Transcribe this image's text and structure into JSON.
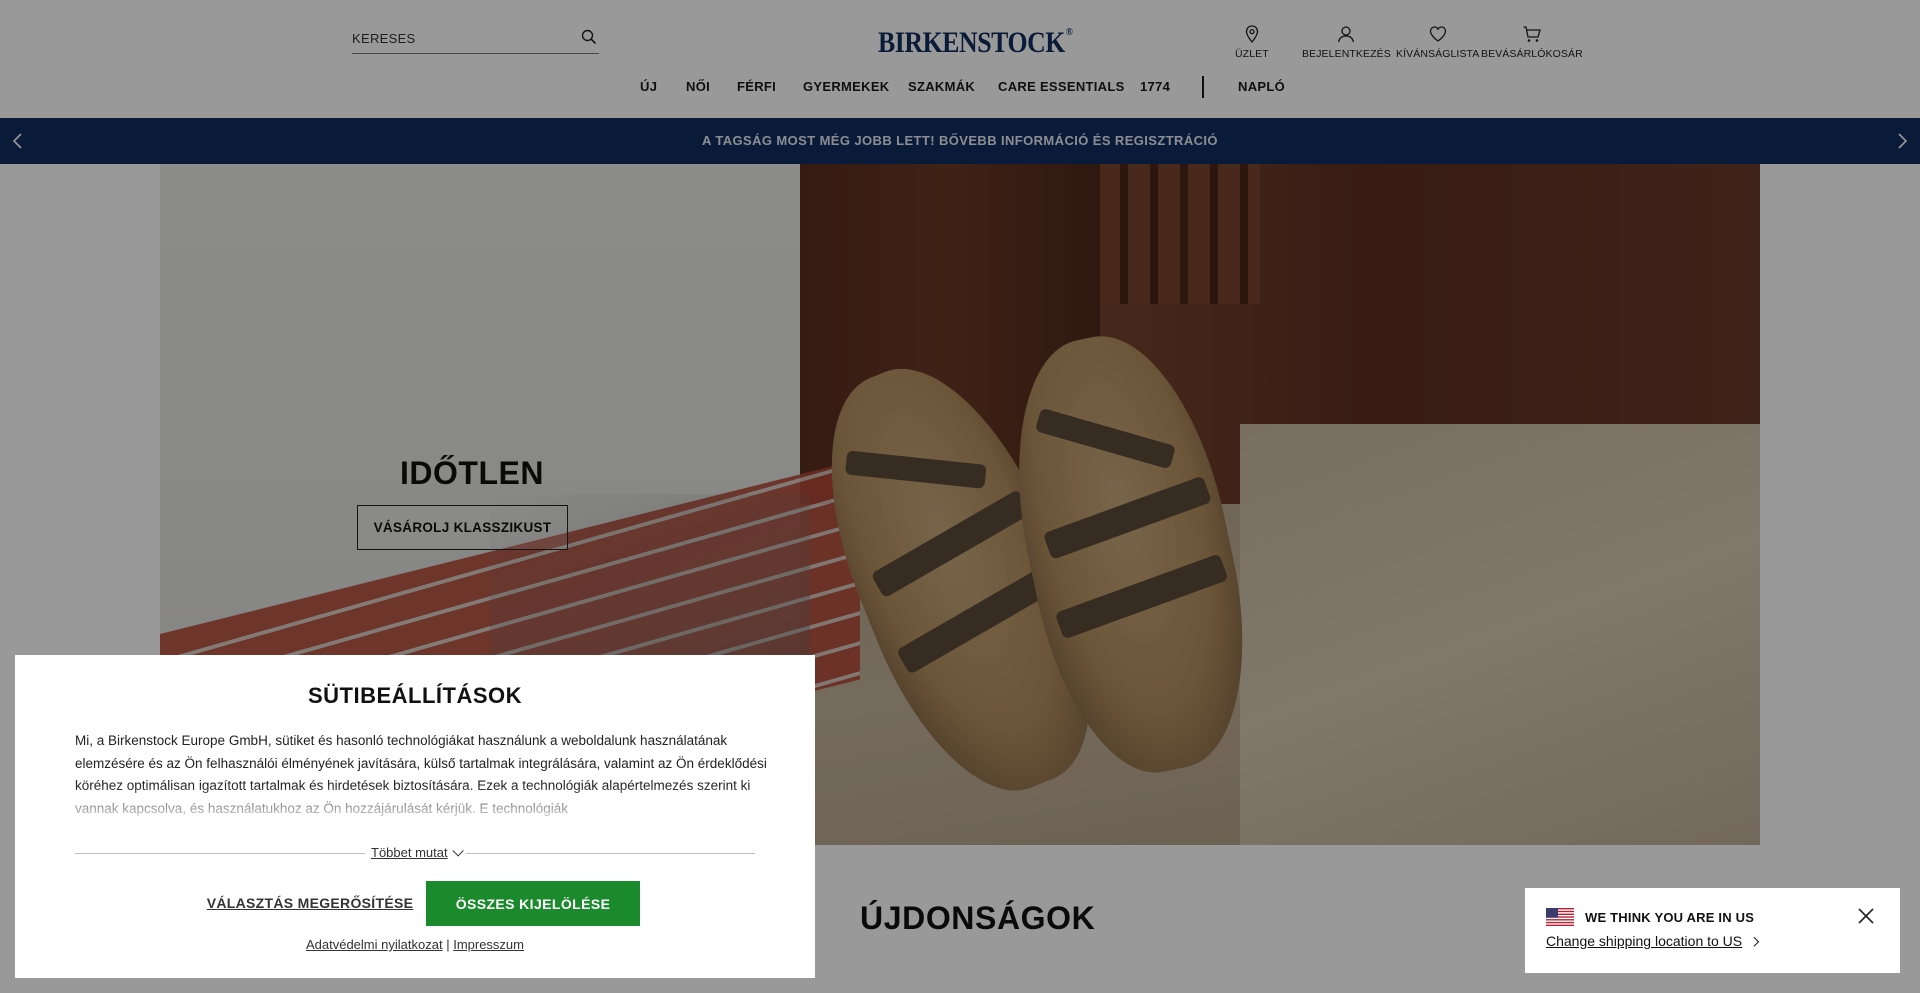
{
  "header": {
    "search_placeholder": "KERESES",
    "logo_text": "BIRKENSTOCK",
    "logo_mark": "®",
    "utility": {
      "store": "ÜZLET",
      "login": "BEJELENTKEZÉS",
      "wishlist": "KÍVÁNSÁGLISTA",
      "cart": "BEVÁSÁRLÓKOSÁR"
    }
  },
  "nav": {
    "items": [
      "ÚJ",
      "NŐI",
      "FÉRFI",
      "GYERMEKEK",
      "SZAKMÁK",
      "CARE ESSENTIALS",
      "1774",
      "NAPLÓ"
    ]
  },
  "promo": {
    "text": "A TAGSÁG MOST MÉG JOBB LETT! BŐVEBB INFORMÁCIÓ ÉS REGISZTRÁCIÓ"
  },
  "hero": {
    "title": "IDŐTLEN",
    "cta": "VÁSÁROLJ KLASSZIKUST"
  },
  "section": {
    "title": "ÚJDONSÁGOK"
  },
  "cookie": {
    "title": "SÜTIBEÁLLÍTÁSOK",
    "body": "Mi, a Birkenstock Europe GmbH, sütiket és hasonló technológiákat használunk a weboldalunk használatának elemzésére és az Ön felhasználói élményének javítására, külső tartalmak integrálására, valamint az Ön érdeklődési köréhez optimálisan igazított tartalmak és hirdetések biztosítására. Ezek a technológiák alapértelmezés szerint ki vannak kapcsolva, és használatukhoz az Ön hozzájárulását kérjük. E technológiák",
    "more": "Többet mutat",
    "confirm": "VÁLASZTÁS MEGERŐSÍTÉSE",
    "accept": "ÖSSZES KIJELÖLÉSE",
    "privacy": "Adatvédelmi nyilatkozat",
    "separator": "|",
    "imprint": "Impresszum",
    "accept_color": "#1b8a2d"
  },
  "geo": {
    "title": "WE THINK YOU ARE IN US",
    "link": "Change shipping location to US"
  },
  "colors": {
    "brand": "#0f2e5e"
  }
}
